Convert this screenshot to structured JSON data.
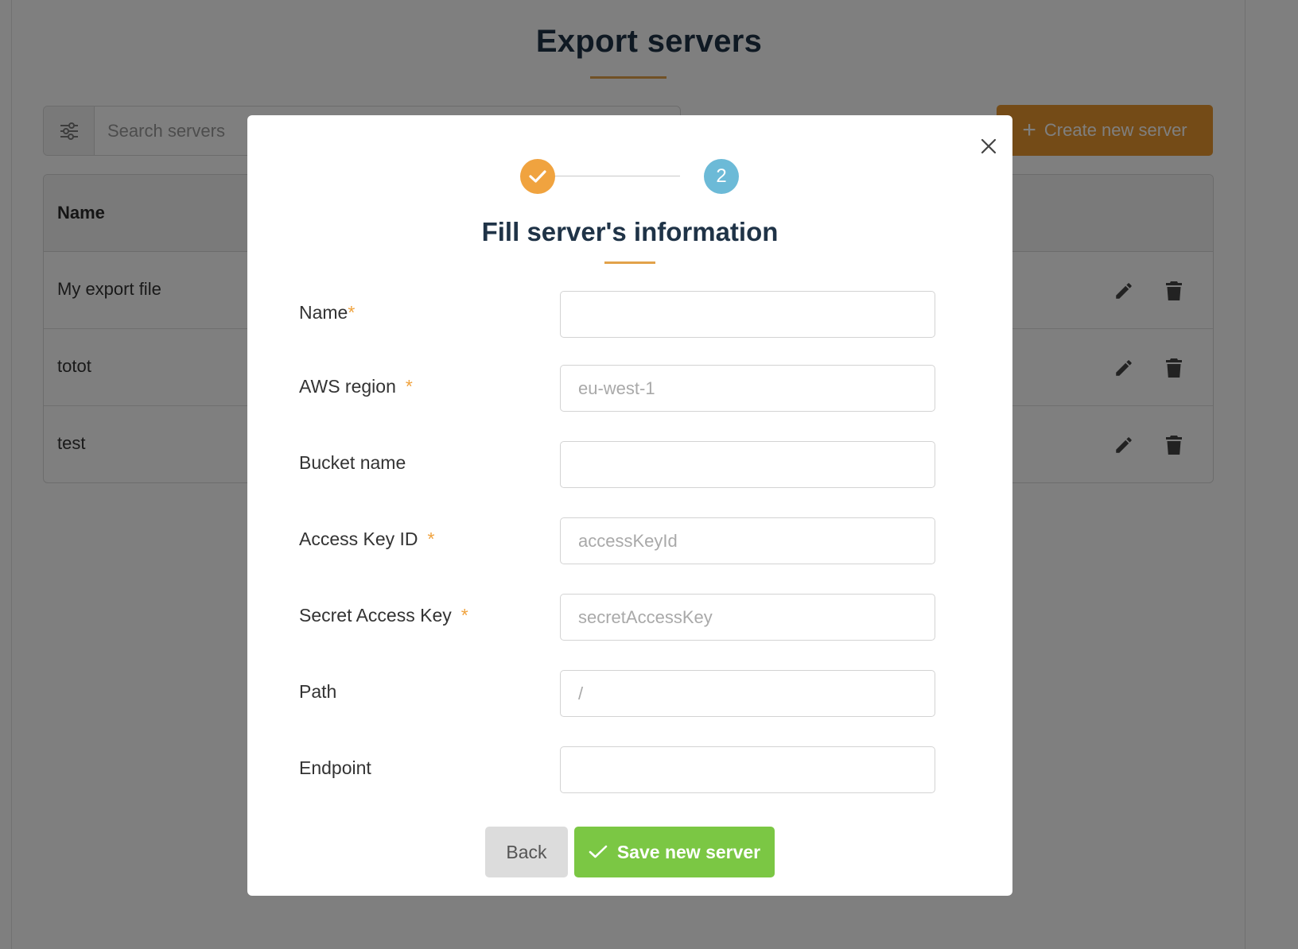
{
  "page": {
    "title": "Export servers",
    "search_placeholder": "Search servers",
    "create_button_label": "Create new server"
  },
  "table": {
    "column_name": "Name",
    "rows": [
      {
        "name": "My export file"
      },
      {
        "name": "totot"
      },
      {
        "name": "test"
      }
    ]
  },
  "modal": {
    "step2_number": "2",
    "title": "Fill server's information",
    "fields": {
      "name": {
        "label": "Name",
        "required": "*",
        "value": "",
        "placeholder": ""
      },
      "aws_region": {
        "label": "AWS region",
        "required": "*",
        "value": "",
        "placeholder": "eu-west-1"
      },
      "bucket_name": {
        "label": "Bucket name",
        "value": "",
        "placeholder": ""
      },
      "access_key_id": {
        "label": "Access Key ID",
        "required": "*",
        "value": "",
        "placeholder": "accessKeyId"
      },
      "secret_access_key": {
        "label": "Secret Access Key",
        "required": "*",
        "value": "",
        "placeholder": "secretAccessKey"
      },
      "path": {
        "label": "Path",
        "value": "",
        "placeholder": "/"
      },
      "endpoint": {
        "label": "Endpoint",
        "value": "",
        "placeholder": ""
      }
    },
    "back_label": "Back",
    "save_label": "Save new server"
  },
  "colors": {
    "accent_orange": "#e8962f",
    "step_done": "#f0a33f",
    "step_current": "#6cbad7",
    "save_green": "#7bc744",
    "title_navy": "#1f3347"
  },
  "icons": {
    "filter": "sliders-icon",
    "plus": "plus-icon",
    "edit": "pencil-icon",
    "delete": "trash-icon",
    "close": "close-icon",
    "step_done": "check-icon",
    "save": "check-icon"
  }
}
